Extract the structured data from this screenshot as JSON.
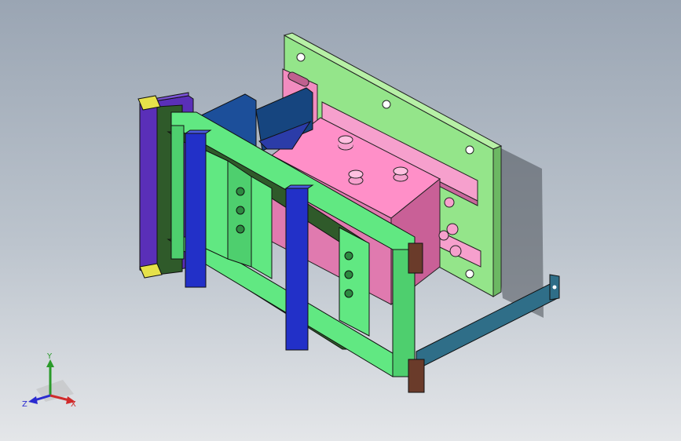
{
  "viewport": {
    "background_top": "#9aa5b3",
    "background_bottom": "#e4e6e9"
  },
  "model": {
    "parts": [
      {
        "name": "back-mounting-plate",
        "color": "#94e58a"
      },
      {
        "name": "pink-cylinder-block",
        "color": "#f28cc0"
      },
      {
        "name": "green-frame",
        "color": "#61e882"
      },
      {
        "name": "dark-green-rails",
        "color": "#2f5a2a"
      },
      {
        "name": "blue-vertical-bars",
        "color": "#2230c8"
      },
      {
        "name": "purple-side-plate",
        "color": "#5a2fb8"
      },
      {
        "name": "navy-top-block",
        "color": "#1c4f9a"
      },
      {
        "name": "teal-support-bracket",
        "color": "#2f6e88"
      },
      {
        "name": "brown-clamp-blocks",
        "color": "#6a3b2a"
      },
      {
        "name": "yellow-clips",
        "color": "#e6e14a"
      }
    ]
  },
  "triad": {
    "y_label": "Y",
    "x_label": "X",
    "z_label": "Z",
    "y_color": "#2a9a2a",
    "x_color": "#d02a2a",
    "z_color": "#2a2ad0"
  }
}
